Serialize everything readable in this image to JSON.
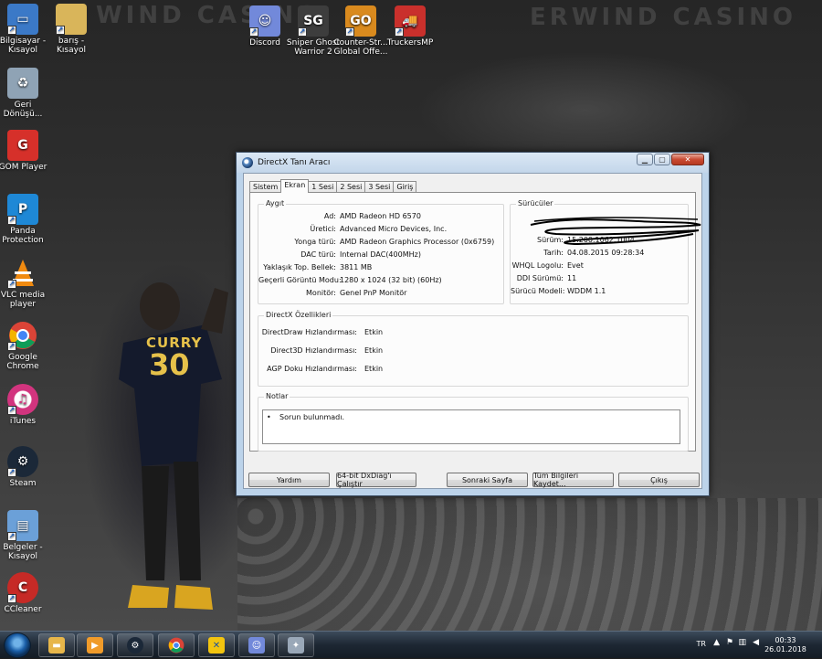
{
  "desktop": {
    "wall_text_left": "WIND CASINO",
    "wall_text_right": "ERWIND CASINO",
    "jersey_name": "CURRY",
    "jersey_number": "30",
    "icons": [
      {
        "label": "Bilgisayar - Kısayol",
        "icon": "computer-icon",
        "color": "#3b79c7"
      },
      {
        "label": "barış - Kısayol",
        "icon": "folder-icon",
        "color": "#d9b55a"
      },
      {
        "label": "Geri Dönüşü...",
        "icon": "recycle-bin-icon",
        "color": "#8fa3b5"
      },
      {
        "label": "GOM Player",
        "icon": "gom-player-icon",
        "color": "#d6302a"
      },
      {
        "label": "Panda Protection",
        "icon": "panda-icon",
        "color": "#1e88d6"
      },
      {
        "label": "VLC media player",
        "icon": "vlc-icon",
        "color": "#f08a10"
      },
      {
        "label": "Google Chrome",
        "icon": "chrome-icon",
        "color": "#2e9d4a"
      },
      {
        "label": "iTunes",
        "icon": "itunes-icon",
        "color": "#d2347e"
      },
      {
        "label": "Steam",
        "icon": "steam-icon",
        "color": "#1b2838"
      },
      {
        "label": "Belgeler - Kısayol",
        "icon": "documents-icon",
        "color": "#6ba0d8"
      },
      {
        "label": "CCleaner",
        "icon": "ccleaner-icon",
        "color": "#c62a26"
      },
      {
        "label": "Discord",
        "icon": "discord-icon",
        "color": "#7289da"
      },
      {
        "label": "Sniper Ghost Warrior 2",
        "icon": "sniper-game-icon",
        "color": "#3d3d3d"
      },
      {
        "label": "Counter-Str... Global Offe...",
        "icon": "csgo-icon",
        "color": "#d98a1e"
      },
      {
        "label": "TruckersMP",
        "icon": "truck-icon",
        "color": "#c9302c"
      }
    ]
  },
  "window": {
    "title": "DirectX Tanı Aracı",
    "tabs": [
      "Sistem",
      "Ekran",
      "1 Sesi",
      "2 Sesi",
      "3 Sesi",
      "Giriş"
    ],
    "active_tab": "Ekran",
    "device": {
      "title": "Aygıt",
      "rows": [
        {
          "label": "Ad:",
          "value": "AMD Radeon HD 6570"
        },
        {
          "label": "Üretici:",
          "value": "Advanced Micro Devices, Inc."
        },
        {
          "label": "Yonga türü:",
          "value": "AMD Radeon Graphics Processor (0x6759)"
        },
        {
          "label": "DAC türü:",
          "value": "Internal DAC(400MHz)"
        },
        {
          "label": "Yaklaşık Top. Bellek:",
          "value": "3811 MB"
        },
        {
          "label": "Geçerli Görüntü Modu:",
          "value": "1280 x 1024 (32 bit) (60Hz)"
        },
        {
          "label": "Monitör:",
          "value": "Genel PnP Monitör"
        }
      ]
    },
    "drivers": {
      "title": "Sürücüler",
      "rows": [
        {
          "label": "Sürüm:",
          "value": "15.200.1062.1004"
        },
        {
          "label": "Tarih:",
          "value": "04.08.2015 09:28:34"
        },
        {
          "label": "WHQL Logolu:",
          "value": "Evet"
        },
        {
          "label": "DDI Sürümü:",
          "value": "11"
        },
        {
          "label": "Sürücü Modeli:",
          "value": "WDDM 1.1"
        }
      ]
    },
    "features": {
      "title": "DirectX Özellikleri",
      "rows": [
        {
          "label": "DirectDraw Hızlandırması:",
          "value": "Etkin"
        },
        {
          "label": "Direct3D Hızlandırması:",
          "value": "Etkin"
        },
        {
          "label": "AGP Doku Hızlandırması:",
          "value": "Etkin"
        }
      ]
    },
    "notes": {
      "title": "Notlar",
      "items": [
        "Sorun bulunmadı."
      ]
    },
    "buttons": {
      "help": "Yardım",
      "run64": "64-bit DxDiag'ı Çalıştır",
      "next": "Sonraki Sayfa",
      "save_all": "Tüm Bilgileri Kaydet...",
      "exit": "Çıkış"
    }
  },
  "taskbar": {
    "items": [
      {
        "icon": "explorer-icon",
        "color": "#e7b64a"
      },
      {
        "icon": "media-player-icon",
        "color": "#f09b2a"
      },
      {
        "icon": "steam-icon",
        "color": "#1b2838"
      },
      {
        "icon": "chrome-icon",
        "color": "#2e9d4a"
      },
      {
        "icon": "xsplit-icon",
        "color": "#f2c40f"
      },
      {
        "icon": "discord-icon",
        "color": "#7289da"
      },
      {
        "icon": "directx-icon",
        "color": "#9aa8b8"
      }
    ],
    "language": "TR",
    "time": "00:33",
    "date": "26.01.2018"
  }
}
